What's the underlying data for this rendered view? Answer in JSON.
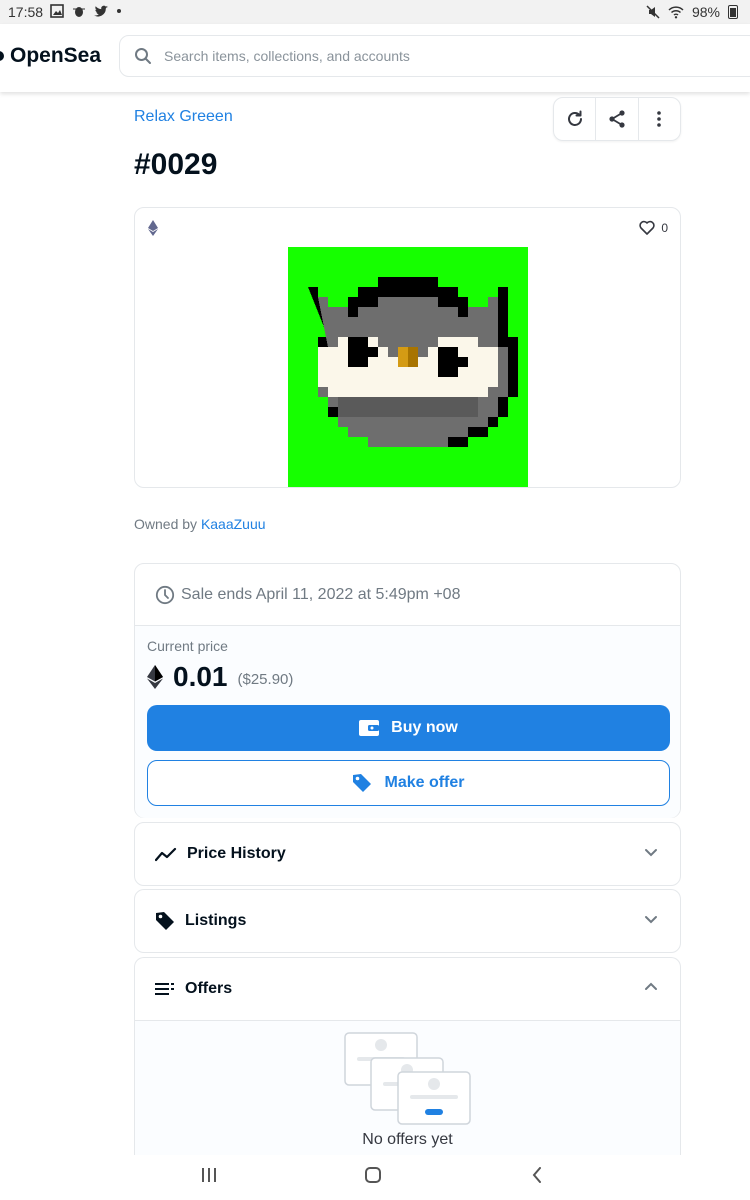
{
  "status_bar": {
    "time": "17:58",
    "battery": "98%"
  },
  "header": {
    "logo": "OpenSea",
    "search_placeholder": "Search items, collections, and accounts"
  },
  "item": {
    "collection": "Relax Greeen",
    "title": "#0029",
    "likes": "0",
    "owned_by_label": "Owned by",
    "owner": "KaaaZuuu",
    "image_bg": "#16ff00"
  },
  "sale": {
    "ends_text": "Sale ends April 11, 2022 at 5:49pm +08",
    "current_price_label": "Current price",
    "price": "0.01",
    "price_usd": "($25.90)",
    "buy_label": "Buy now",
    "offer_label": "Make offer"
  },
  "sections": {
    "price_history": "Price History",
    "listings": "Listings",
    "offers": "Offers",
    "no_offers": "No offers yet"
  },
  "colors": {
    "accent": "#2081e2",
    "text_dark": "#04111d",
    "border": "#e5e8eb"
  }
}
